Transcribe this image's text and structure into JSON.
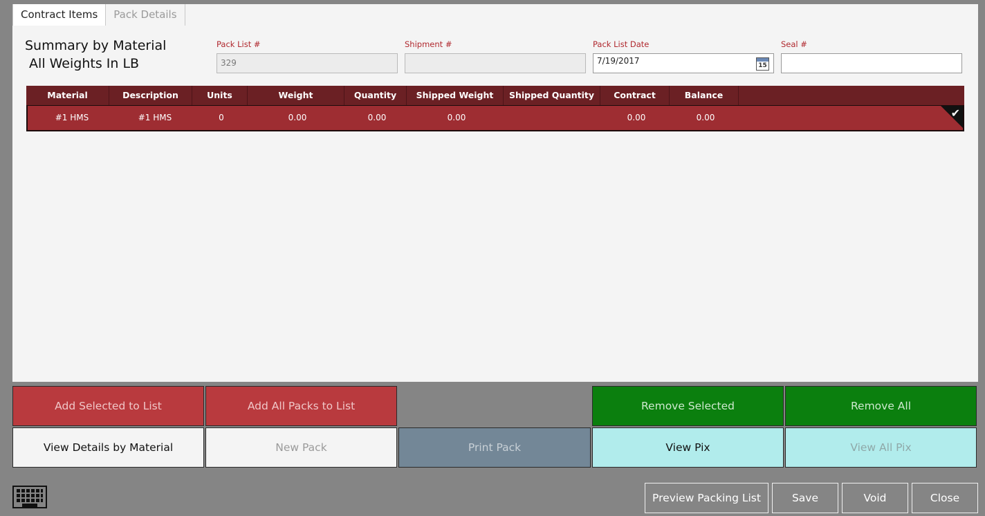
{
  "tabs": [
    {
      "label": "Contract Items",
      "active": true
    },
    {
      "label": "Pack Details",
      "active": false
    }
  ],
  "summary": {
    "line1": "Summary by Material",
    "line2": " All Weights In LB"
  },
  "fields": {
    "pack_list": {
      "label": "Pack List #",
      "value": "329"
    },
    "shipment": {
      "label": "Shipment #",
      "value": ""
    },
    "pack_list_date": {
      "label": "Pack List Date",
      "value": "7/19/2017",
      "calendar_day": "15"
    },
    "seal": {
      "label": "Seal #",
      "value": ""
    }
  },
  "grid": {
    "columns": [
      "Material",
      "Description",
      "Units",
      "Weight",
      "Quantity",
      "Shipped Weight",
      "Shipped Quantity",
      "Contract",
      "Balance"
    ],
    "rows": [
      {
        "material": "#1 HMS",
        "description": "#1 HMS",
        "units": "0",
        "weight": "0.00",
        "quantity": "0.00",
        "shipped_weight": "0.00",
        "shipped_quantity": "",
        "contract": "0.00",
        "balance": "0.00",
        "selected": true
      }
    ]
  },
  "actions": {
    "add_selected": "Add Selected to List",
    "add_all_packs": "Add All Packs to List",
    "remove_selected": "Remove Selected",
    "remove_all": "Remove All",
    "view_details": "View Details by Material",
    "new_pack": "New Pack",
    "print_pack": "Print Pack",
    "view_pix": "View Pix",
    "view_all_pix": "View All Pix"
  },
  "footer": {
    "preview": "Preview Packing List",
    "save": "Save",
    "void": "Void",
    "close": "Close"
  },
  "colors": {
    "header_dark_red": "#6b2024",
    "row_red": "#9e2d32",
    "button_red": "#b93a3e",
    "button_green": "#0b7f0e",
    "button_aqua": "#b1ecec",
    "button_slate": "#738797",
    "label_red": "#b0282e"
  }
}
